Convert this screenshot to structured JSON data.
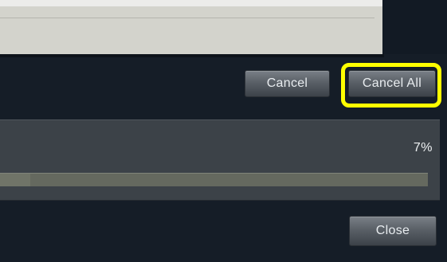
{
  "dialog": {
    "buttons": {
      "cancel_label": "Cancel",
      "cancel_all_label": "Cancel All",
      "close_label": "Close"
    },
    "progress": {
      "percent_text": "7%",
      "value": 0.07
    }
  },
  "colors": {
    "background": "#151d27",
    "highlight": "#ffff00",
    "button_text": "#e8ecef",
    "panel": "#3c4248"
  }
}
